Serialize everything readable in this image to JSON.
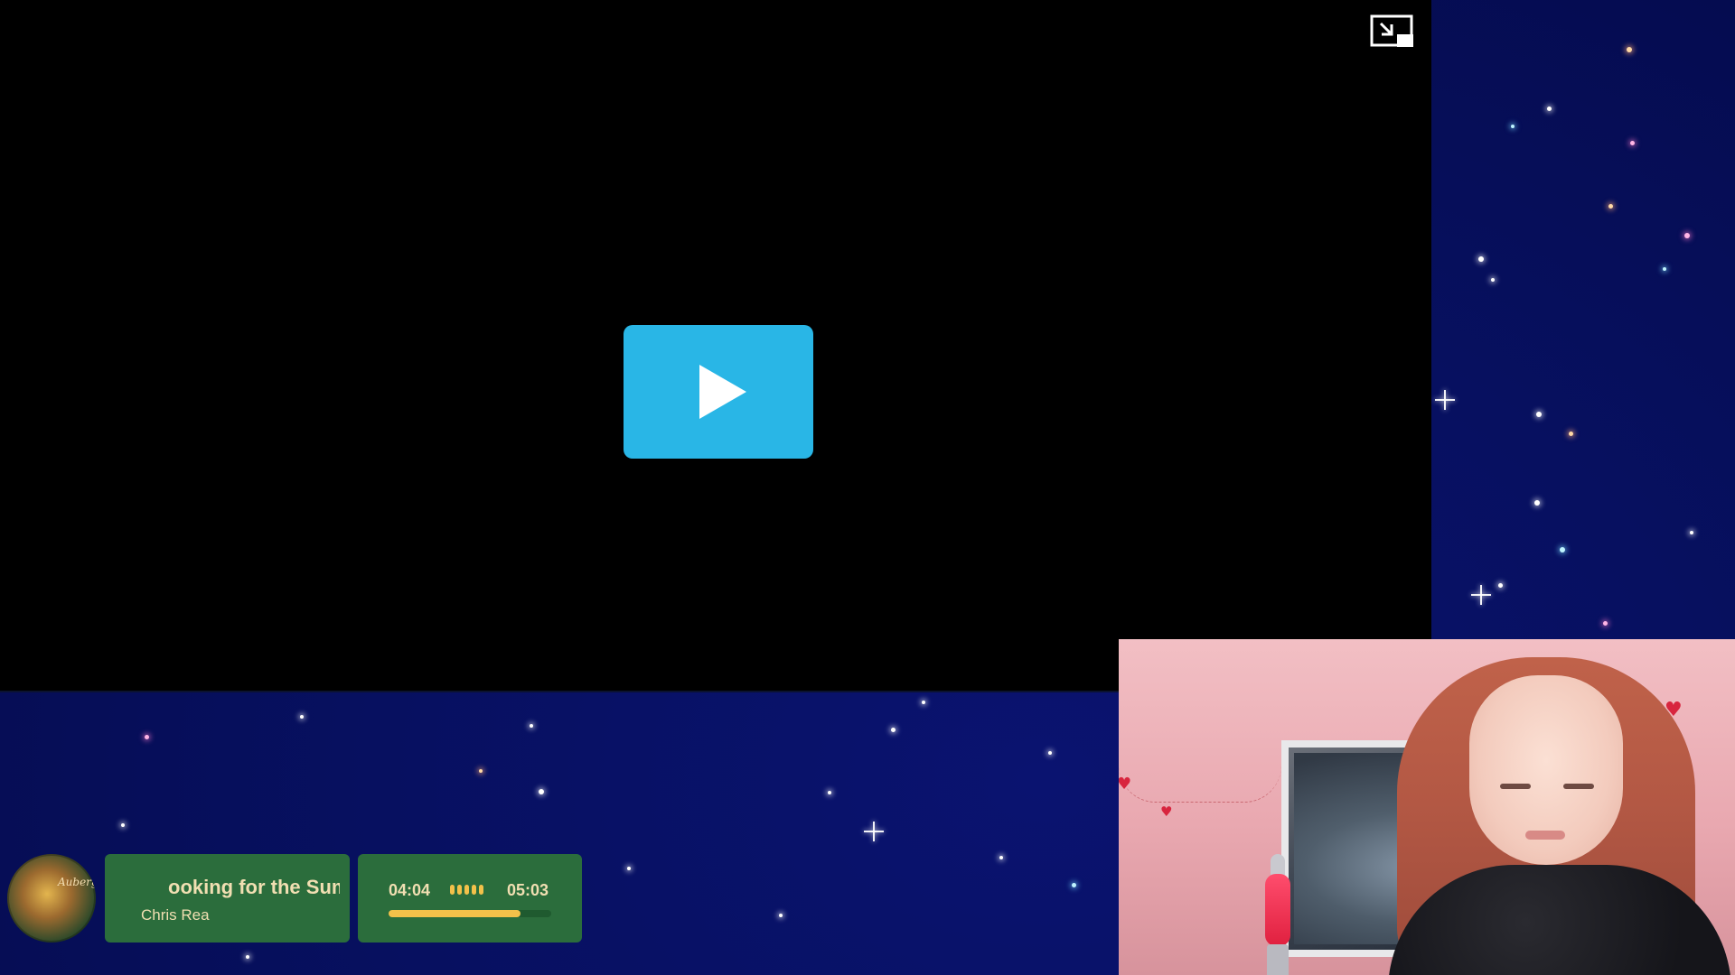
{
  "video_player": {
    "play_icon": "play-icon",
    "pip_icon": "picture-in-picture-exit-icon",
    "play_button_color": "#29b6e6"
  },
  "music_widget": {
    "track_title": "ooking for the Sum",
    "artist": "Chris Rea",
    "album_art_script": "Auberge",
    "elapsed": "04:04",
    "duration": "05:03",
    "progress_fraction": 0.81,
    "card_color": "#2b6d3c",
    "accent_color": "#f3c14a",
    "text_color": "#f1dfb2"
  },
  "background": {
    "colors": [
      "#040a4a",
      "#0a1370"
    ]
  }
}
